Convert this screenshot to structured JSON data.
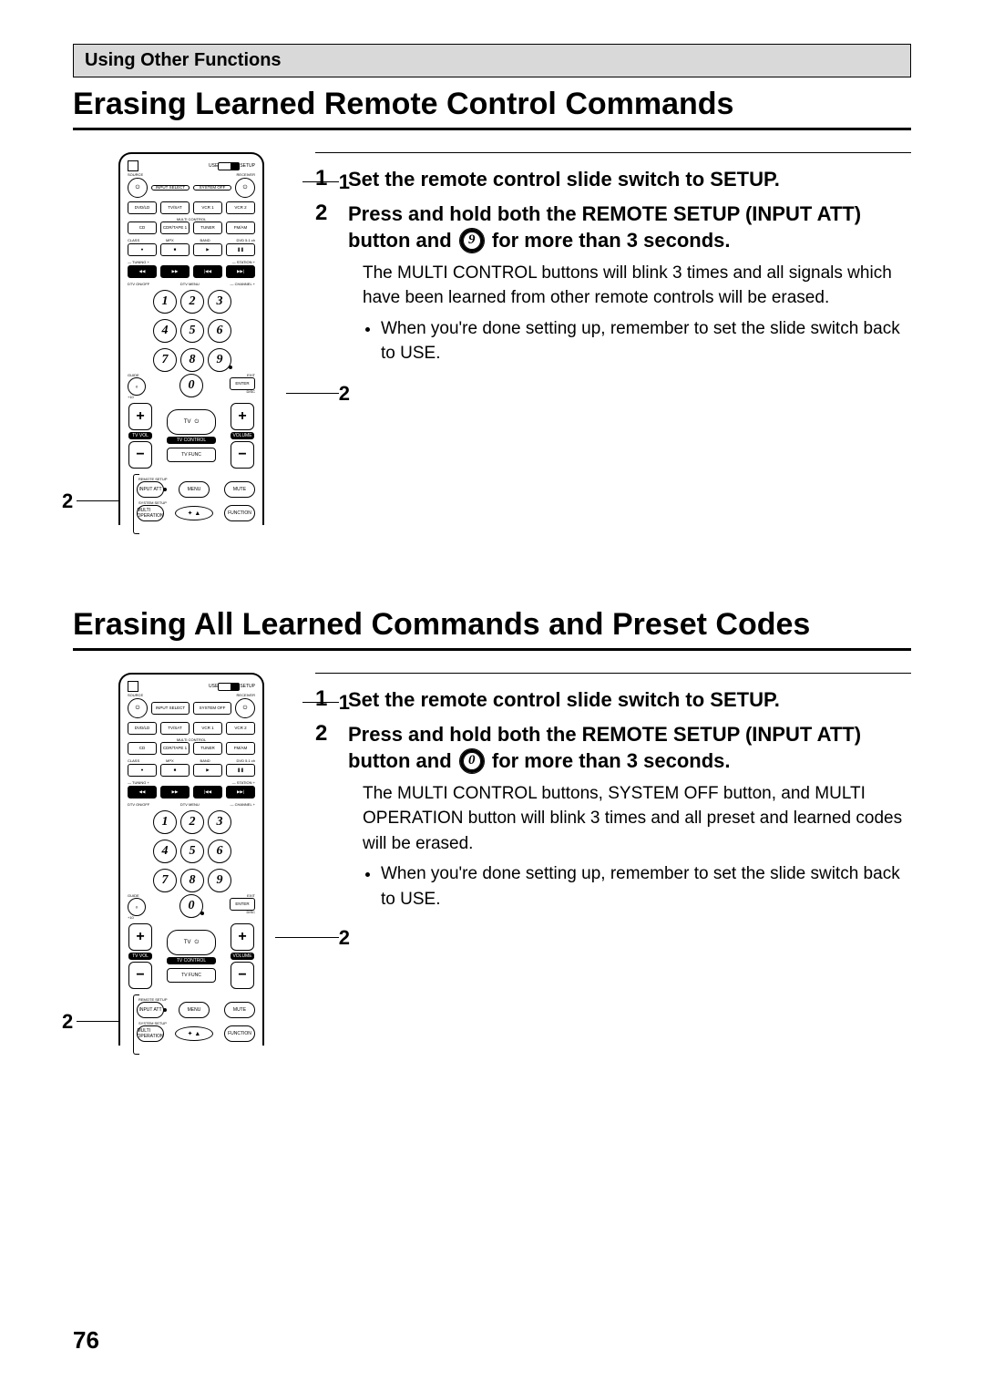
{
  "section_header": "Using Other Functions",
  "page_number": "76",
  "remote": {
    "slide_label_left": "USE",
    "slide_label_right": "SETUP",
    "top_row_labels": [
      "SOURCE",
      "",
      "RECEIVER"
    ],
    "top_row_center_top": "INPUT SELECT",
    "top_row_center_bottom": "SYSTEM OFF",
    "multi_label": "MULTI CONTROL",
    "func_row1": [
      "DVD/LD",
      "TV/SAT",
      "VCR 1",
      "VCR 2"
    ],
    "func_row2": [
      "CD",
      "CDR/TAPE 1",
      "TUNER",
      "FM/AM"
    ],
    "trans_labels": [
      "CLASS",
      "MPX",
      "BAND",
      "DVD 5.1 ch"
    ],
    "trans_icons": [
      "●",
      "■",
      "▶",
      "❚❚"
    ],
    "tuning_left": "—  TUNING  +",
    "tuning_right": "—  STATION  +",
    "seek_icons": [
      "◀◀",
      "▶▶",
      "|◀◀",
      "▶▶|"
    ],
    "dtv_labels": [
      "DTV ON/OFF",
      "DTV MENU",
      "—  CHANNEL  +"
    ],
    "num_keys": [
      "1",
      "2",
      "3",
      "4",
      "5",
      "6",
      "7",
      "8",
      "9",
      "0"
    ],
    "bottom_side_left_top": "GUIDE",
    "bottom_side_left_bottom": "+10",
    "bottom_side_right_top": "EXIT",
    "bottom_side_right_bottom": "DISC",
    "enter_btn": "ENTER",
    "center_oval_tv": "TV",
    "vol_labels": [
      "TV VOL",
      "TV CONTROL",
      "VOLUME"
    ],
    "tv_func": "TV FUNC",
    "remote_setup_label": "REMOTE SETUP",
    "input_att": "INPUT ATT",
    "system_setup_label": "SYSTEM SETUP",
    "multi_op": "MULTI OPERATION",
    "menu_btn": "MENU",
    "mute_btn": "MUTE",
    "function_btn": "FUNCTION"
  },
  "callouts": {
    "one": "1",
    "two_right": "2",
    "two_left": "2"
  },
  "sections": [
    {
      "heading": "Erasing Learned Remote Control Commands",
      "steps": [
        {
          "title": "Set the remote control slide switch to SETUP."
        },
        {
          "title_before": "Press and hold both the REMOTE SETUP (INPUT ATT) button and ",
          "key": "9",
          "title_after": " for more than 3 seconds.",
          "body": "The MULTI CONTROL buttons will blink 3 times and all signals which have been learned from other remote controls will be erased.",
          "bullet": "When you're done setting up, remember to set the slide switch back to USE."
        }
      ]
    },
    {
      "heading": "Erasing All Learned Commands and Preset Codes",
      "steps": [
        {
          "title": "Set the remote control slide switch to SETUP."
        },
        {
          "title_before": "Press and hold both the REMOTE SETUP (INPUT ATT) button and ",
          "key": "0",
          "title_after": " for more than 3 seconds.",
          "body": "The MULTI CONTROL buttons, SYSTEM OFF button, and MULTI OPERATION button will blink 3 times and all preset and learned codes will be erased.",
          "bullet": "When you're done setting up, remember to set the slide switch back to USE."
        }
      ]
    }
  ]
}
